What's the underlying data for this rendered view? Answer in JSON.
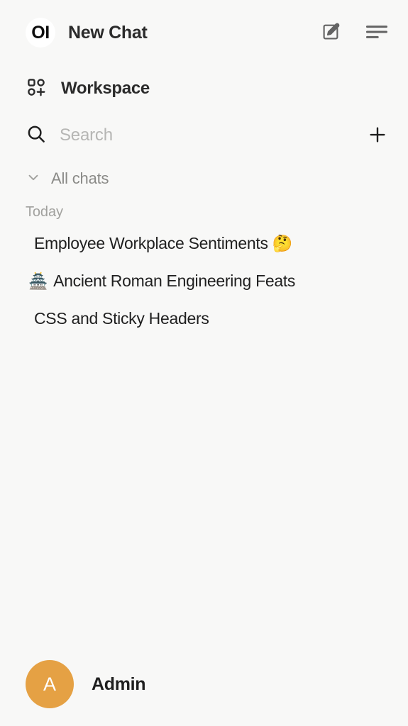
{
  "colors": {
    "background": "#f8f8f7",
    "text_primary": "#1f1f1f",
    "text_muted": "#8a8a87",
    "placeholder": "#b6b6b4",
    "avatar_bg": "#e5a144",
    "icon": "#636363"
  },
  "header": {
    "logo_text": "OI",
    "logo_icon": "openwebui-logo-icon",
    "title": "New Chat",
    "edit_icon": "pencil-square-icon",
    "collapse_icon": "sidebar-toggle-icon"
  },
  "workspace": {
    "label": "Workspace",
    "icon": "grid-plus-icon"
  },
  "search": {
    "placeholder": "Search",
    "value": "",
    "icon": "search-icon",
    "new_chat_icon": "plus-icon"
  },
  "all_chats": {
    "label": "All chats",
    "icon": "chevron-down-icon",
    "expanded": true
  },
  "chat_groups": [
    {
      "title": "Today",
      "items": [
        {
          "emoji": "",
          "title": "Employee Workplace Sentiments 🤔"
        },
        {
          "emoji": "🏯",
          "title": "Ancient Roman Engineering Feats"
        },
        {
          "emoji": "",
          "title": "CSS and Sticky Headers"
        }
      ]
    }
  ],
  "user": {
    "initial": "A",
    "name": "Admin"
  }
}
